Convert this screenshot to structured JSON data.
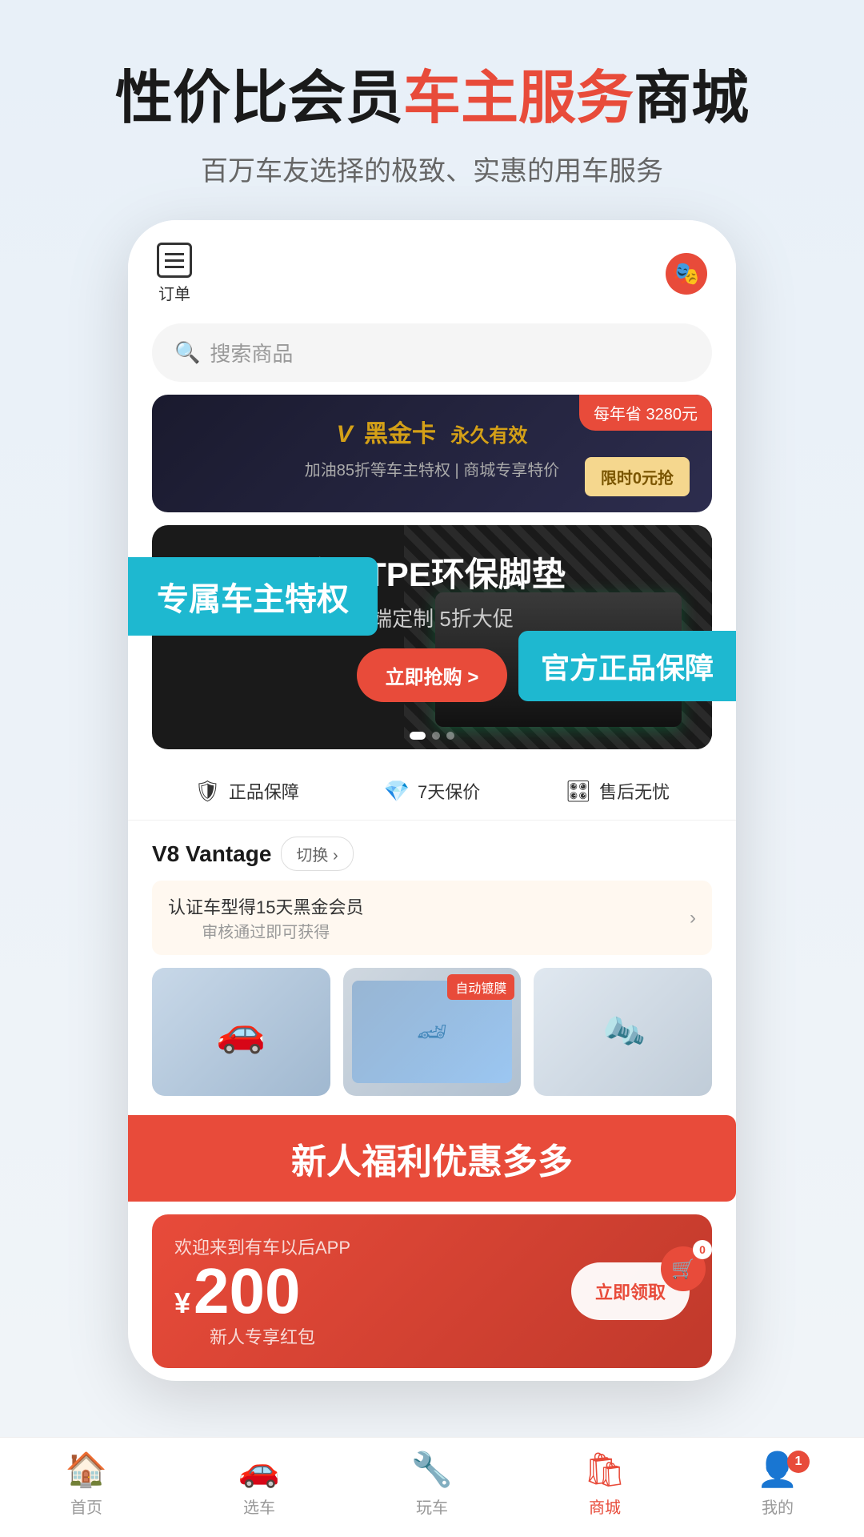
{
  "hero": {
    "title_part1": "性价比会员",
    "title_highlight": "车主服务",
    "title_part2": "商城",
    "subtitle": "百万车友选择的极致、实惠的用车服务"
  },
  "app": {
    "order_label": "订单",
    "search_placeholder": "搜索商品",
    "avatar_emoji": "🎭"
  },
  "black_card": {
    "save_badge": "每年省 3280元",
    "title_v": "V",
    "title_name": "黑金卡",
    "title_forever": "永久有效",
    "desc": "加油85折等车主特权 | 商城专享特价",
    "btn_label": "限时0元抢"
  },
  "product_banner": {
    "title": "砖叔TPE环保脚垫",
    "subtitle": "高端定制 5折大促",
    "btn_label": "立即抢购 >"
  },
  "trust_badges": [
    {
      "icon": "🛡",
      "label": "正品保障"
    },
    {
      "icon": "💎",
      "label": "7天保价"
    },
    {
      "icon": "🎛",
      "label": "售后无忧"
    }
  ],
  "car_section": {
    "model": "V8 Vantage",
    "switch_btn": "切换 ›",
    "member_text": "认证车型得15天黑金会员",
    "member_sub": "审核通过即可获得",
    "auto_badge": "自动镀膜"
  },
  "new_user": {
    "welcome": "欢迎来到有车以后APP",
    "amount_sup": "¥",
    "amount": "200",
    "desc": "新人专享红包",
    "btn_label": "立即领取"
  },
  "callouts": {
    "owner_privilege": "专属车主特权",
    "official_guarantee": "官方正品保障",
    "new_user_benefit": "新人福利优惠多多"
  },
  "bottom_nav": [
    {
      "icon": "🏠",
      "label": "首页",
      "active": false
    },
    {
      "icon": "🚗",
      "label": "选车",
      "active": false
    },
    {
      "icon": "🔧",
      "label": "玩车",
      "active": false
    },
    {
      "icon": "🛍",
      "label": "商城",
      "active": true
    },
    {
      "icon": "👤",
      "label": "我的",
      "active": false
    }
  ],
  "cart_badge": "0",
  "message_badge": "1"
}
